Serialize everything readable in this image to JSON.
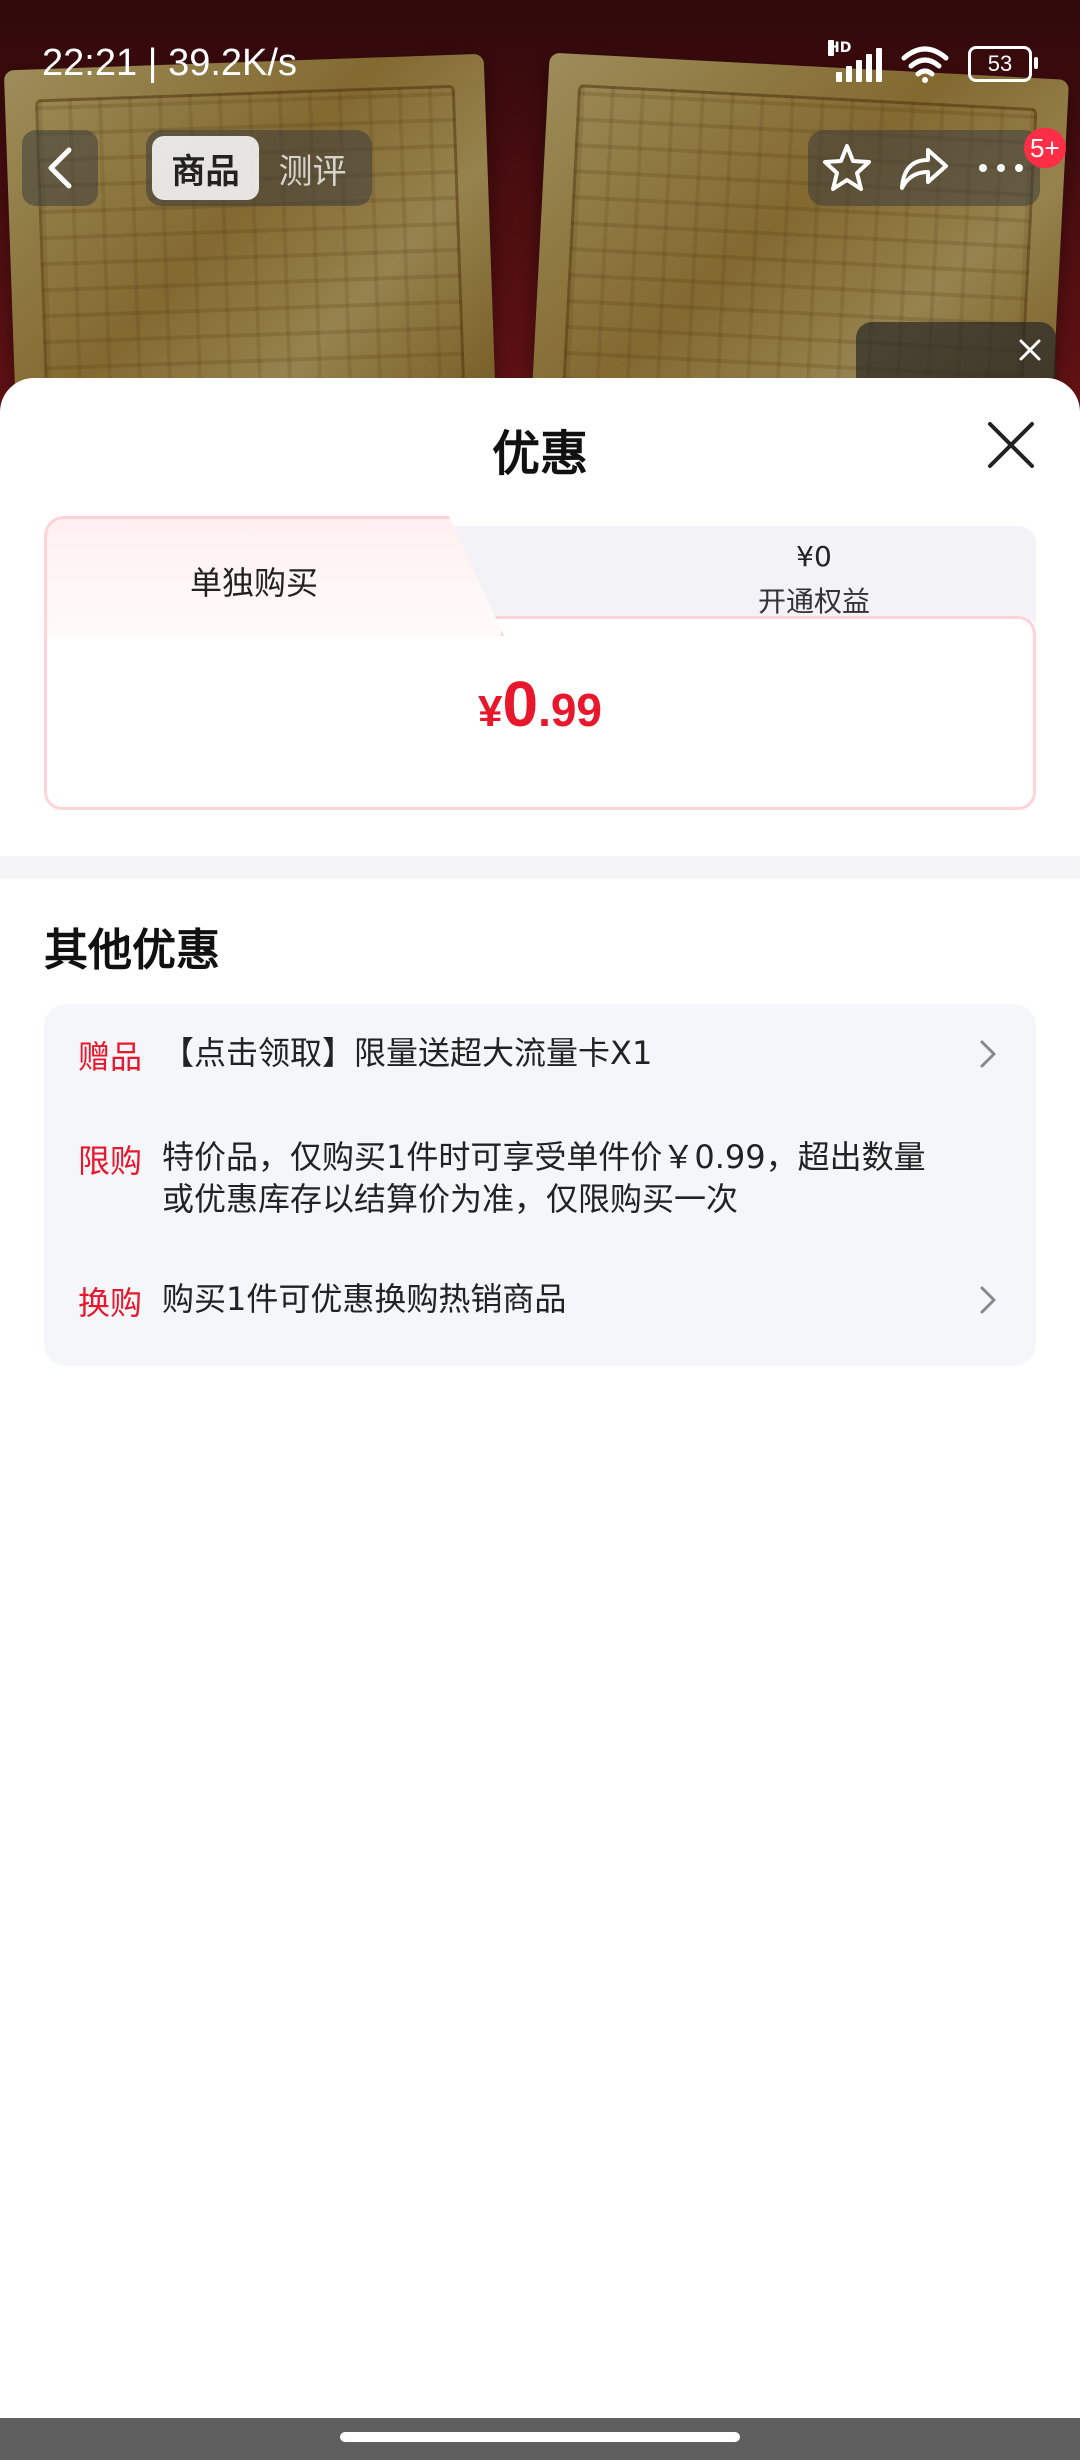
{
  "status_bar": {
    "time": "22:21 | 39.2K/s",
    "network_tag": "HD",
    "battery": "53"
  },
  "nav": {
    "tabs": [
      {
        "label": "商品",
        "active": true
      },
      {
        "label": "测评",
        "active": false
      }
    ],
    "badge": "5+",
    "icons": [
      "back-icon",
      "star-icon",
      "share-icon",
      "more-icon"
    ]
  },
  "sheet": {
    "title": "优惠",
    "price_tabs": {
      "left_label": "单独购买",
      "right_price": "¥0",
      "right_label": "开通权益"
    },
    "price": {
      "symbol": "¥",
      "integer": "0",
      "decimal": ".99"
    },
    "other_title": "其他优惠",
    "promotions": [
      {
        "tag": "赠品",
        "text": "【点击领取】限量送超大流量卡X1",
        "has_chevron": true
      },
      {
        "tag": "限购",
        "text": "特价品，仅购买1件时可享受单件价￥0.99，超出数量或优惠库存以结算价为准，仅限购买一次",
        "has_chevron": false
      },
      {
        "tag": "换购",
        "text": "购买1件可优惠换购热销商品",
        "has_chevron": true
      }
    ]
  },
  "colors": {
    "accent_red": "#e8172c",
    "tab_border_pink": "#ffd3d8",
    "card_bg": "#f5f6fa"
  }
}
